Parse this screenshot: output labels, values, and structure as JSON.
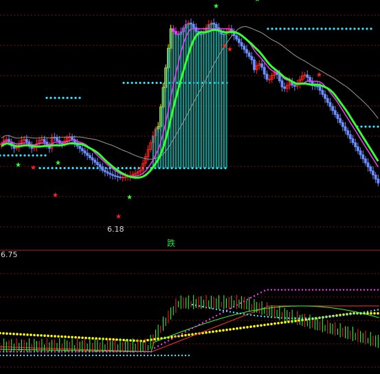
{
  "chart_data": [
    {
      "type": "candlestick",
      "panel": "main",
      "title": "",
      "annotations": {
        "low_label": "6.18",
        "signal_label": "跌"
      },
      "colors": {
        "up": "#ff2222",
        "down": "#6a8cff",
        "bull_fill": "#1fa6a0",
        "ma_fast": "#33ff33",
        "ma_slow": "#ff33ff",
        "ma_long": "#9a9a9a",
        "support_dots": "#33e5ff",
        "highlight_yellow": "#ffff00",
        "highlight_magenta": "#ff33ff"
      },
      "levels": [
        {
          "name": "support-left",
          "value": 6.85
        },
        {
          "name": "support-mid",
          "value": 6.74
        },
        {
          "name": "resist-left",
          "value": 7.35
        },
        {
          "name": "resist-right",
          "value": 7.48
        },
        {
          "name": "high-line",
          "value": 7.95
        },
        {
          "name": "right-lower",
          "value": 7.1
        }
      ]
    },
    {
      "type": "line",
      "panel": "indicator",
      "title": "",
      "ytick_top": "6.75",
      "series": [
        {
          "name": "",
          "color": "#ffff00"
        },
        {
          "name": "",
          "color": "#ff3333"
        },
        {
          "name": "",
          "color": "#33ff33"
        },
        {
          "name": "",
          "color": "#ff33ff"
        },
        {
          "name": "",
          "color": "#55ddff"
        }
      ]
    }
  ]
}
